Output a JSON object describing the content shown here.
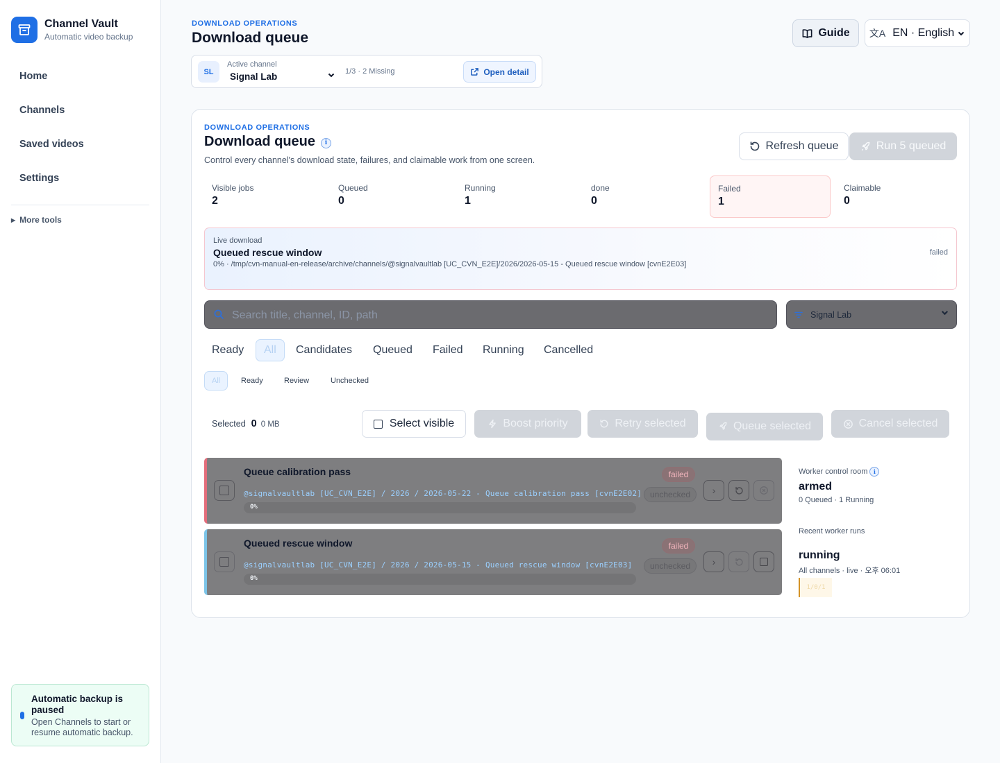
{
  "brand": {
    "name": "Channel Vault",
    "subtitle": "Automatic video backup"
  },
  "nav": {
    "items": [
      "Home",
      "Channels",
      "Saved videos",
      "Settings"
    ],
    "more_tools": "More tools"
  },
  "paused_notice": {
    "title": "Automatic backup is paused",
    "body": "Open Channels to start or resume automatic backup."
  },
  "header": {
    "eyebrow": "DOWNLOAD OPERATIONS",
    "title": "Download queue",
    "guide_label": "Guide",
    "language_label": "EN · English"
  },
  "channel_bar": {
    "avatar": "SL",
    "label": "Active channel",
    "name": "Signal Lab",
    "meta": "1/3 · 2 Missing",
    "open_detail": "Open detail"
  },
  "card": {
    "eyebrow": "DOWNLOAD OPERATIONS",
    "title": "Download queue",
    "description": "Control every channel's download state, failures, and claimable work from one screen.",
    "refresh_label": "Refresh queue",
    "run_label": "Run 5 queued"
  },
  "stats": [
    {
      "label": "Visible jobs",
      "value": "2"
    },
    {
      "label": "Queued",
      "value": "0"
    },
    {
      "label": "Running",
      "value": "1"
    },
    {
      "label": "done",
      "value": "0"
    },
    {
      "label": "Failed",
      "value": "1"
    },
    {
      "label": "Claimable",
      "value": "0"
    }
  ],
  "live_download": {
    "label": "Live download",
    "title": "Queued rescue window",
    "detail": "0% · /tmp/cvn-manual-en-release/archive/channels/@signalvaultlab [UC_CVN_E2E]/2026/2026-05-15 - Queued rescue window [cvnE2E03]",
    "status": "failed"
  },
  "search": {
    "placeholder": "Search title, channel, ID, path"
  },
  "channel_filter": {
    "value": "Signal Lab"
  },
  "tabs": [
    "Ready",
    "All",
    "Candidates",
    "Queued",
    "Failed",
    "Running",
    "Cancelled"
  ],
  "active_tab": "All",
  "subtabs": [
    "All",
    "Ready",
    "Review",
    "Unchecked"
  ],
  "selection": {
    "label": "Selected",
    "count": "0",
    "size": "0 MB",
    "select_visible": "Select visible",
    "boost": "Boost priority",
    "retry": "Retry selected",
    "queue": "Queue selected",
    "cancel": "Cancel selected"
  },
  "jobs": [
    {
      "title": "Queue calibration pass",
      "path": "@signalvaultlab [UC_CVN_E2E] / 2026 / 2026-05-22 - Queue calibration pass [cvnE2E02]",
      "progress": "0%",
      "status": "failed",
      "check": "unchecked"
    },
    {
      "title": "Queued rescue window",
      "path": "@signalvaultlab [UC_CVN_E2E] / 2026 / 2026-05-15 - Queued rescue window [cvnE2E03]",
      "progress": "0%",
      "status": "failed",
      "check": "unchecked"
    }
  ],
  "worker": {
    "title": "Worker control room",
    "state": "armed",
    "summary": "0 Queued · 1 Running",
    "recent_label": "Recent worker runs",
    "recent_state": "running",
    "recent_meta": "All channels · live · 오후 06:01",
    "recent_counts": "1/0/1"
  },
  "colors": {
    "accent": "#1f6fe5",
    "failed": "#e36d7b",
    "queued": "#7cc4e8"
  }
}
